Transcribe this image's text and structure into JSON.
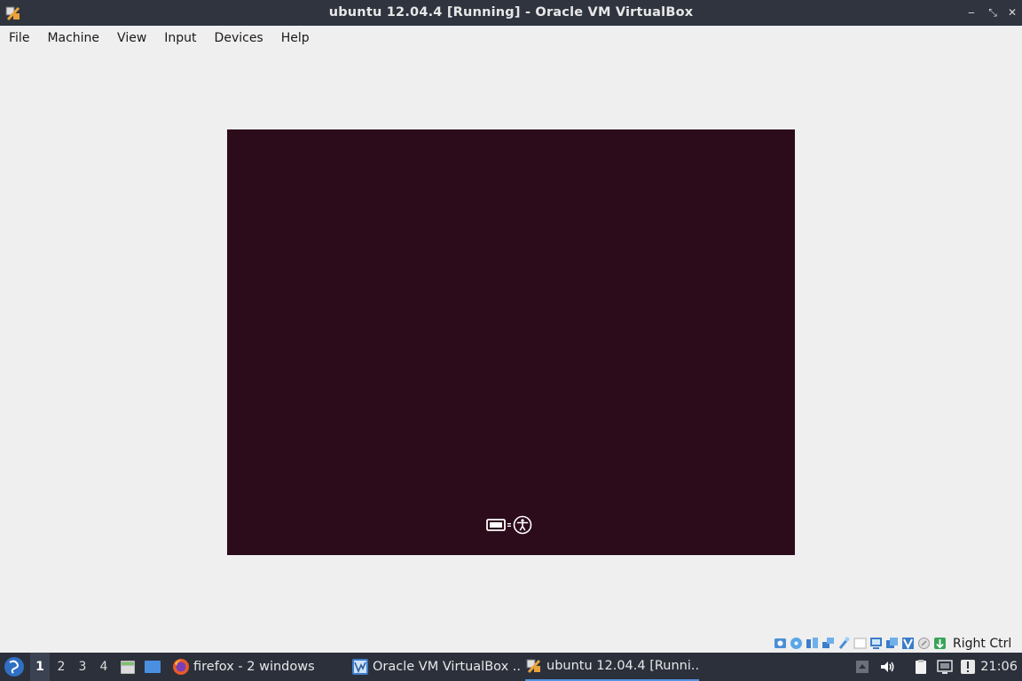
{
  "window": {
    "title": "ubuntu 12.04.4 [Running] - Oracle VM VirtualBox",
    "controls": [
      "minimize-icon",
      "maximize-icon",
      "close-icon"
    ]
  },
  "menubar": {
    "items": [
      "File",
      "Machine",
      "View",
      "Input",
      "Devices",
      "Help"
    ]
  },
  "vm": {
    "screen_color": "#2c0b1b",
    "indicators": [
      "keyboard-icon",
      "accessibility-icon"
    ]
  },
  "statusbar": {
    "icons": [
      "hard-disk-icon",
      "optical-drive-icon",
      "audio-icon",
      "network-icon",
      "usb-icon",
      "shared-folders-icon",
      "display-icon",
      "video-capture-icon",
      "virtualization-icon",
      "mouse-integration-icon",
      "keyboard-capture-icon"
    ],
    "host_key": "Right Ctrl"
  },
  "taskbar": {
    "desktops": [
      "1",
      "2",
      "3",
      "4"
    ],
    "active_desktop": "1",
    "quicklaunch": [
      "file-manager-icon",
      "show-desktop-icon"
    ],
    "tasks": [
      {
        "label": "firefox - 2 windows",
        "icon": "firefox-icon"
      },
      {
        "label": "Oracle VM VirtualBox ...",
        "icon": "virtualbox-manager-icon"
      },
      {
        "label": "ubuntu 12.04.4 [Runni...",
        "icon": "virtualbox-icon"
      }
    ],
    "tray": [
      "tray-up-arrow-icon",
      "volume-icon",
      "clipboard-icon",
      "network-monitor-icon",
      "update-notifier-icon"
    ],
    "clock": "21:06"
  },
  "colors": {
    "titlebar_bg": "#2f343f",
    "taskbar_bg": "#2b303b",
    "window_bg": "#efefef",
    "accent": "#5294e2"
  }
}
